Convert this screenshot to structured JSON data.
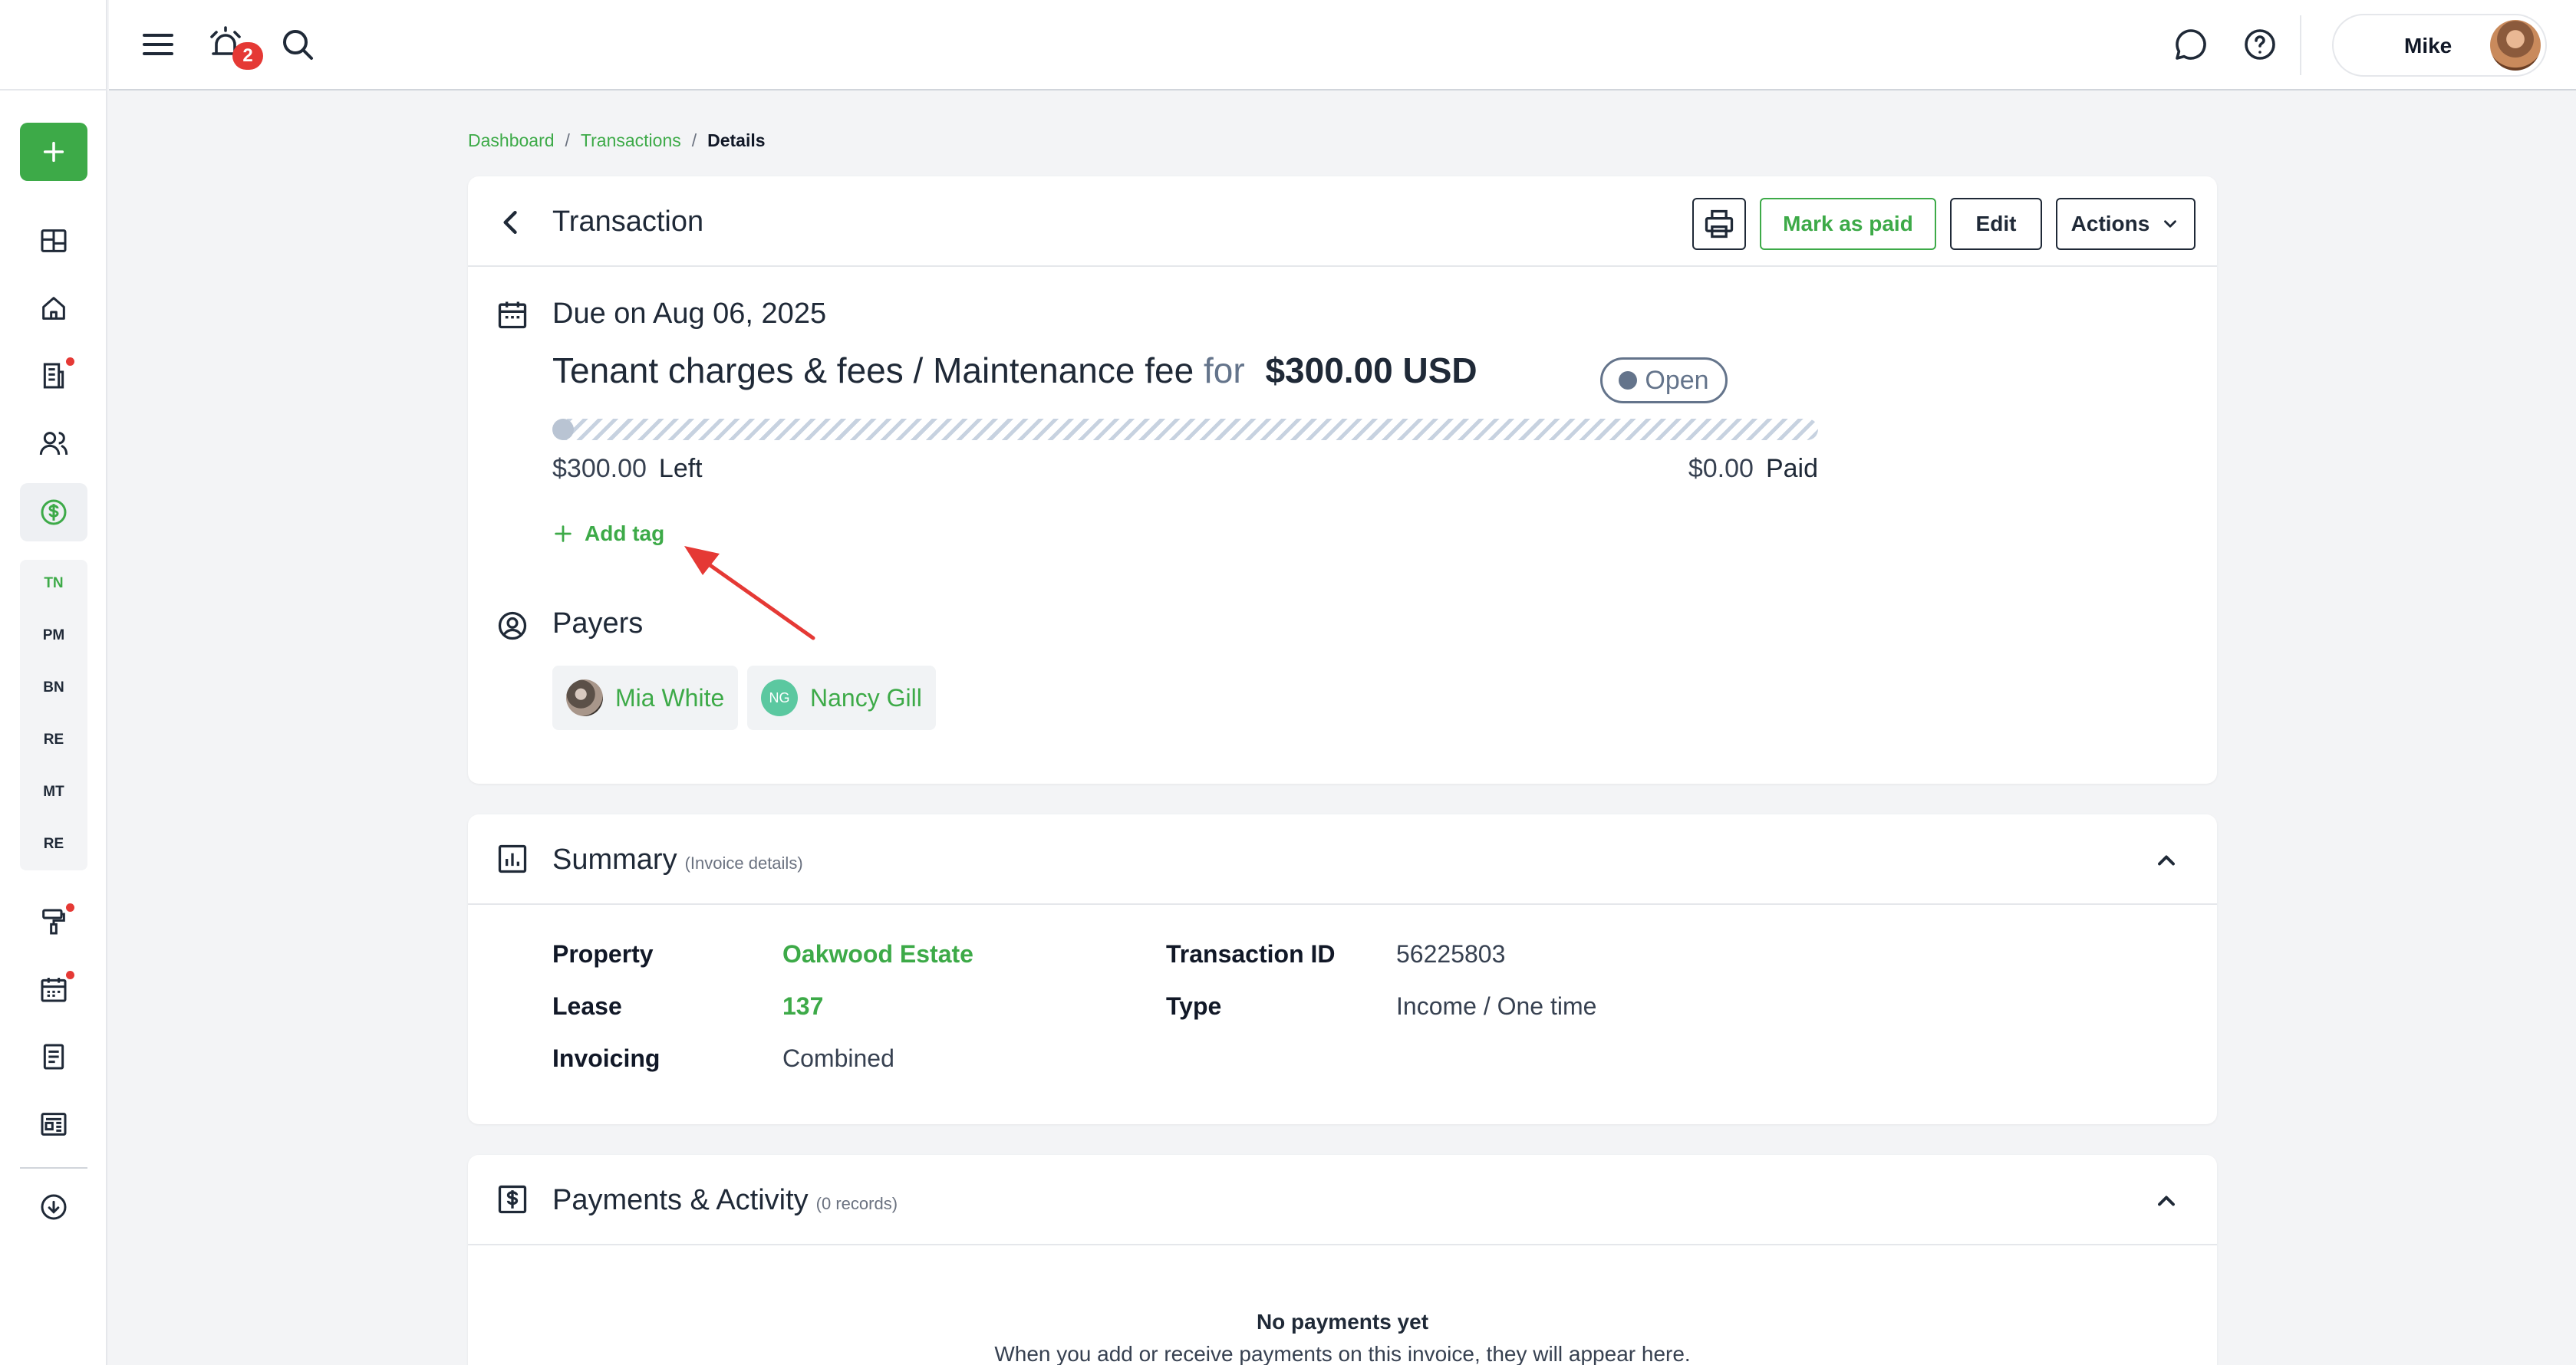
{
  "topbar": {
    "notification_count": "2",
    "user_name": "Mike"
  },
  "sidebar": {
    "sub_items": [
      "TN",
      "PM",
      "BN",
      "RE",
      "MT",
      "RE"
    ]
  },
  "breadcrumb": {
    "items": [
      "Dashboard",
      "Transactions"
    ],
    "current": "Details"
  },
  "transaction": {
    "title": "Transaction",
    "buttons": {
      "mark_paid": "Mark as paid",
      "edit": "Edit",
      "actions": "Actions"
    },
    "due": "Due on Aug 06, 2025",
    "category": "Tenant charges & fees / Maintenance fee",
    "for_word": "for",
    "amount": "$300.00 USD",
    "status": "Open",
    "progress_paid_fraction": 0,
    "left_amount": "$300.00",
    "left_label": "Left",
    "paid_amount": "$0.00",
    "paid_label": "Paid",
    "add_tag": "Add tag",
    "payers_title": "Payers",
    "payers": [
      {
        "name": "Mia White",
        "initials": ""
      },
      {
        "name": "Nancy Gill",
        "initials": "NG"
      }
    ]
  },
  "summary": {
    "title": "Summary",
    "subtitle": "(Invoice details)",
    "property_label": "Property",
    "property_value": "Oakwood Estate",
    "lease_label": "Lease",
    "lease_value": "137",
    "invoicing_label": "Invoicing",
    "invoicing_value": "Combined",
    "txid_label": "Transaction ID",
    "txid_value": "56225803",
    "type_label": "Type",
    "type_value": "Income / One time"
  },
  "payments": {
    "title": "Payments & Activity",
    "subtitle": "(0 records)",
    "empty_title": "No payments yet",
    "empty_desc": "When you add or receive payments on this invoice, they will appear here."
  },
  "colors": {
    "brand_green": "#3daa48",
    "badge_red": "#e53935",
    "status_gray": "#64748b"
  }
}
